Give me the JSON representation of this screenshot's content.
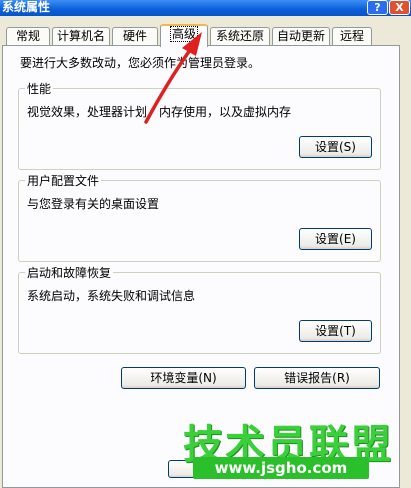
{
  "window": {
    "title": "系统属性",
    "help_glyph": "?",
    "close_glyph": "X"
  },
  "tabs": [
    {
      "label": "常规"
    },
    {
      "label": "计算机名"
    },
    {
      "label": "硬件"
    },
    {
      "label": "高级"
    },
    {
      "label": "系统还原"
    },
    {
      "label": "自动更新"
    },
    {
      "label": "远程"
    }
  ],
  "active_tab": "高级",
  "notice": "要进行大多数改动，您必须作为管理员登录。",
  "performance": {
    "title": "性能",
    "description": "视觉效果，处理器计划，内存使用，以及虚拟内存",
    "settings_button": "设置(S)"
  },
  "user_profiles": {
    "title": "用户配置文件",
    "description": "与您登录有关的桌面设置",
    "settings_button": "设置(E)"
  },
  "startup_recovery": {
    "title": "启动和故障恢复",
    "description": "系统启动，系统失败和调试信息",
    "settings_button": "设置(T)"
  },
  "buttons": {
    "env_vars": "环境变量(N)",
    "error_report": "错误报告(R)"
  },
  "watermark": {
    "text": "技术员联盟",
    "url": "www.jsgho.com"
  },
  "colors": {
    "title_bar": "#0a5fd8",
    "active_tab_highlight": "#f1b84a",
    "arrow": "#e02020",
    "watermark": "#3ccf3c"
  }
}
